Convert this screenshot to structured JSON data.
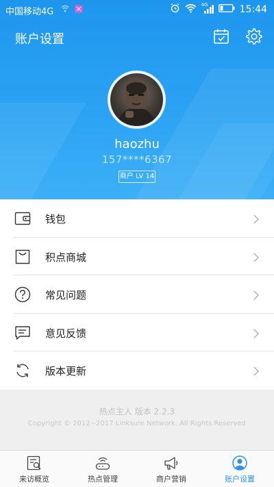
{
  "status_bar": {
    "carrier": "中国移动4G",
    "network_small": "4G",
    "time": "15:44"
  },
  "header": {
    "title": "账户设置",
    "calendar_icon": "calendar-check-icon",
    "settings_icon": "gear-icon"
  },
  "profile": {
    "username": "haozhu",
    "phone": "157****6367",
    "level_badge": "商户 LV 14"
  },
  "menu": [
    {
      "label": "钱包",
      "icon": "wallet-icon"
    },
    {
      "label": "积点商城",
      "icon": "shopping-bag-icon"
    },
    {
      "label": "常见问题",
      "icon": "question-circle-icon"
    },
    {
      "label": "意见反馈",
      "icon": "feedback-message-icon"
    },
    {
      "label": "版本更新",
      "icon": "refresh-icon"
    }
  ],
  "footer": {
    "version": "热点主人 版本 2.2.3",
    "copyright": "Copyright © 2012~2017 Linksure Network. All Rights Reserved"
  },
  "tabs": [
    {
      "label": "来访概览",
      "icon": "visit-overview-icon",
      "active": false
    },
    {
      "label": "热点管理",
      "icon": "wifi-router-icon",
      "active": false
    },
    {
      "label": "商户营销",
      "icon": "megaphone-icon",
      "active": false
    },
    {
      "label": "账户设置",
      "icon": "user-circle-icon",
      "active": true
    }
  ],
  "colors": {
    "accent": "#2b95eb",
    "header_bg": "#1d96ee",
    "text_dark": "#222222",
    "footer_text": "#c2c2c2"
  }
}
